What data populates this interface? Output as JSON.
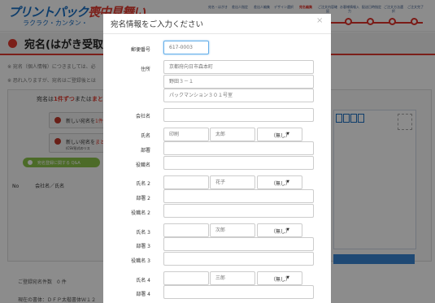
{
  "brand": {
    "logo_main": "プリントパック",
    "logo_accent": "喪中見舞い",
    "tagline": "ラクラク・カンタン・"
  },
  "steps": [
    {
      "label": "宛名・はがき"
    },
    {
      "label": "差出人指定"
    },
    {
      "label": "差出人編集"
    },
    {
      "label": "デザイン選択"
    },
    {
      "label": "宛名編集",
      "active": true
    },
    {
      "label": "ご注文内容確認"
    },
    {
      "label": "お客様情報入力"
    },
    {
      "label": "配送日時指定"
    },
    {
      "label": "ご注文方法選択"
    },
    {
      "label": "ご注文完了"
    }
  ],
  "page": {
    "title": "宛名(はがき受取人",
    "note1": "※ 宛名（個人情報）につきましては、必",
    "note2": "※ 恐れ入りますが、宛名はご登録後とは"
  },
  "panel": {
    "instruction_a": "宛名は",
    "instruction_b": "1件ずつ",
    "instruction_c": "または",
    "instruction_d": "まと",
    "btn_new_a": "新しい宛名を",
    "btn_new_b": "1件",
    "btn_csv_a": "新しい宛名を",
    "btn_csv_b": "まと",
    "btn_csv_c": "(CSV形式のリス",
    "btn_green": "宛名登録に関する Q&A",
    "col_no": "No",
    "col_company": "会社名／氏名"
  },
  "bottom": {
    "count": "ご登録宛名件数　0 件",
    "font": "現在の書体：ＤＦＰ太楷書体Ｗ１２"
  },
  "modal": {
    "title": "宛名情報をご入力ください",
    "close": "×",
    "zip_label": "郵便番号",
    "zip_placeholder": "617-0003",
    "addr_label": "住所",
    "addr1_placeholder": "京都府向日市森本町",
    "addr2_placeholder": "野田３－１",
    "addr3_placeholder": "パックマンション３０１号室",
    "company_label": "会社名",
    "name_label": "氏名",
    "sei_placeholder": "印刷",
    "mei_placeholder": "太郎",
    "dept_label": "部署",
    "role_label": "役職名",
    "name2_label": "氏名 2",
    "mei2_placeholder": "花子",
    "dept2_label": "部署 2",
    "role2_label": "役職名 2",
    "name3_label": "氏名 3",
    "mei3_placeholder": "次郎",
    "dept3_label": "部署 3",
    "role3_label": "役職名 3",
    "name4_label": "氏名 4",
    "mei4_placeholder": "三郎",
    "dept4_label": "部署 4",
    "honorific": "（無し）",
    "select_arrow": "▼"
  },
  "colors": {
    "brand_blue": "#1a6fc4",
    "brand_red": "#e03a2f",
    "focus": "#66afe9"
  }
}
